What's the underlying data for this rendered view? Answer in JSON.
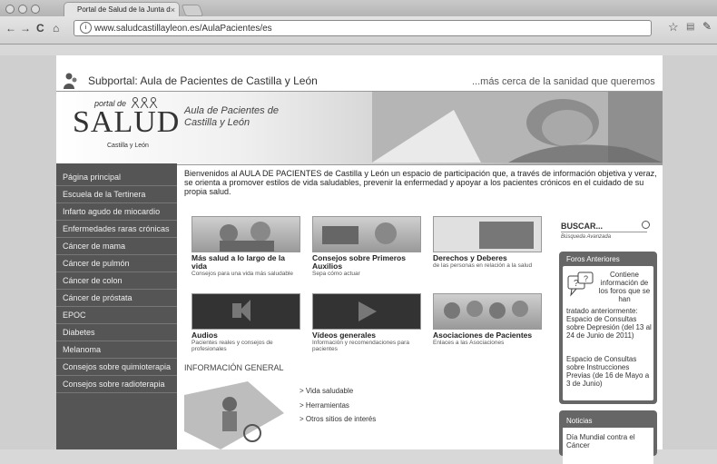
{
  "browser": {
    "tab_title": "Portal de Salud de la Junta d",
    "url": "www.saludcastillayleon.es/AulaPacientes/es"
  },
  "subportal": {
    "title": "Subportal: Aula de Pacientes de Castilla y León",
    "slogan": "...más cerca de la sanidad que queremos"
  },
  "logo": {
    "portal_de": "portal de",
    "salud": "SALUD",
    "region": "Castilla y León"
  },
  "header": {
    "aula_title": "Aula de Pacientes de Castilla y León"
  },
  "sidebar": {
    "items": [
      {
        "label": "Página principal"
      },
      {
        "label": "Escuela de la Tertinera"
      },
      {
        "label": "Infarto agudo de miocardio"
      },
      {
        "label": "Enfermedades raras crónicas"
      },
      {
        "label": "Cáncer de mama"
      },
      {
        "label": "Cáncer de pulmón"
      },
      {
        "label": "Cáncer de colon"
      },
      {
        "label": "Cáncer de próstata"
      },
      {
        "label": "EPOC"
      },
      {
        "label": "Diabetes"
      },
      {
        "label": "Melanoma"
      },
      {
        "label": "Consejos sobre quimioterapia"
      },
      {
        "label": "Consejos sobre radioterapia"
      }
    ]
  },
  "welcome_text": "Bienvenidos al AULA DE PACIENTES de Castilla y León un espacio de participación que, a través de información objetiva y veraz, se orienta a promover estilos de vida saludables, prevenir la enfermedad y apoyar a los pacientes crónicos en el cuidado de su propia salud.",
  "cards": [
    {
      "title": "Más salud a lo largo de la vida",
      "desc": "Consejos para una vida más saludable"
    },
    {
      "title": "Consejos sobre Primeros Auxilios",
      "desc": "Sepa cómo actuar"
    },
    {
      "title": "Derechos y Deberes",
      "desc": "de las personas en relación a la salud"
    },
    {
      "title": "Audios",
      "desc": "Pacientes reales y consejos de profesionales"
    },
    {
      "title": "Vídeos generales",
      "desc": "Información y recomendaciones para pacientes"
    },
    {
      "title": "Asociaciones de Pacientes",
      "desc": "Enlaces a las Asociaciones"
    }
  ],
  "info_general": {
    "heading": "INFORMACIÓN GENERAL",
    "links": [
      "> Vida saludable",
      "> Herramientas",
      "> Otros sitios de interés"
    ]
  },
  "search": {
    "label": "BUSCAR...",
    "advanced": "Búsqueda Avanzada"
  },
  "foros": {
    "title": "Foros Anteriores",
    "text1": "Contiene información de los foros que se han",
    "text2": "tratado anteriormente: Espacio de Consultas sobre Depresión (del 13 al 24 de Junio de 2011)",
    "text3": "Espacio de Consultas sobre Instrucciones Previas (de 16 de Mayo a 3 de Junio)"
  },
  "noticias": {
    "title": "Noticias",
    "text": "Día Mundial contra el Cáncer"
  }
}
